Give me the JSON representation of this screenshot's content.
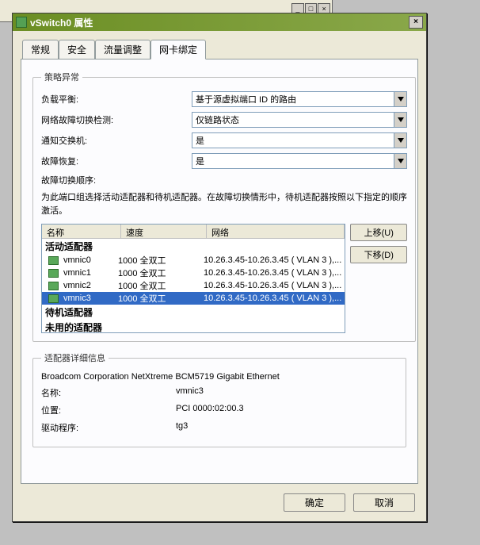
{
  "window": {
    "title": "vSwitch0 属性"
  },
  "tabs": {
    "items": [
      "常规",
      "安全",
      "流量调整",
      "网卡绑定"
    ],
    "active": 3
  },
  "policy": {
    "legend": "策略异常",
    "lb_label": "负载平衡:",
    "lb_value": "基于源虚拟端口 ID 的路由",
    "fod_label": "网络故障切换检测:",
    "fod_value": "仅链路状态",
    "notify_label": "通知交换机:",
    "notify_value": "是",
    "failback_label": "故障恢复:",
    "failback_value": "是",
    "order_label": "故障切换顺序:",
    "help_text": "为此端口组选择活动适配器和待机适配器。在故障切换情形中，待机适配器按照以下指定的顺序激活。"
  },
  "list": {
    "col_name": "名称",
    "col_speed": "速度",
    "col_net": "网络",
    "group_active": "活动适配器",
    "group_standby": "待机适配器",
    "group_unused": "未用的适配器",
    "rows": [
      {
        "name": "vmnic0",
        "speed": "1000 全双工",
        "net": "10.26.3.45-10.26.3.45 ( VLAN 3 ),..."
      },
      {
        "name": "vmnic1",
        "speed": "1000 全双工",
        "net": "10.26.3.45-10.26.3.45 ( VLAN 3 ),..."
      },
      {
        "name": "vmnic2",
        "speed": "1000 全双工",
        "net": "10.26.3.45-10.26.3.45 ( VLAN 3 ),..."
      },
      {
        "name": "vmnic3",
        "speed": "1000 全双工",
        "net": "10.26.3.45-10.26.3.45 ( VLAN 3 ),..."
      }
    ],
    "selected_index": 3,
    "btn_up": "上移(U)",
    "btn_down": "下移(D)"
  },
  "details": {
    "legend": "适配器详细信息",
    "vendor": "Broadcom Corporation NetXtreme BCM5719 Gigabit Ethernet",
    "name_label": "名称:",
    "name_value": "vmnic3",
    "loc_label": "位置:",
    "loc_value": "PCI 0000:02:00.3",
    "drv_label": "驱动程序:",
    "drv_value": "tg3"
  },
  "buttons": {
    "ok": "确定",
    "cancel": "取消"
  }
}
